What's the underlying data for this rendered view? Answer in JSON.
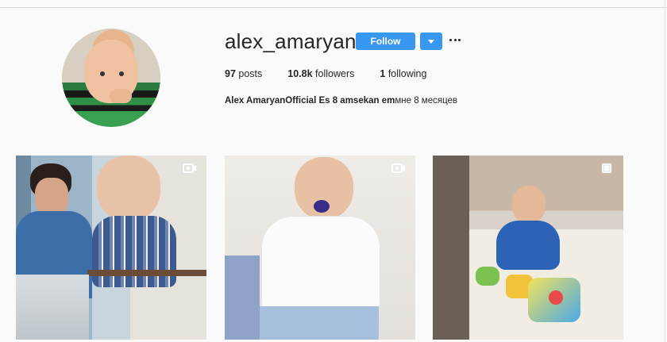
{
  "profile": {
    "username": "alex_amaryan",
    "follow_label": "Follow",
    "stats": [
      {
        "value": "97",
        "label": "posts"
      },
      {
        "value": "10.8k",
        "label": "followers"
      },
      {
        "value": "1",
        "label": "following"
      }
    ],
    "bio_name": "Alex Amaryan",
    "bio_rest": "Official Es 8 amsekan em",
    "bio_ru": "мне 8 месяцев",
    "bio_placeholder_1": "",
    "bio_placeholder_2": "",
    "bio_placeholder_3": "",
    "bio_placeholder_4": ""
  },
  "posts": [
    {
      "type": "video",
      "icon": "camera-icon"
    },
    {
      "type": "video",
      "icon": "camera-icon"
    },
    {
      "type": "carousel",
      "icon": "multiple-images-icon"
    }
  ],
  "colors": {
    "accent": "#3897f0",
    "background": "#fafafa",
    "text": "#262626"
  }
}
